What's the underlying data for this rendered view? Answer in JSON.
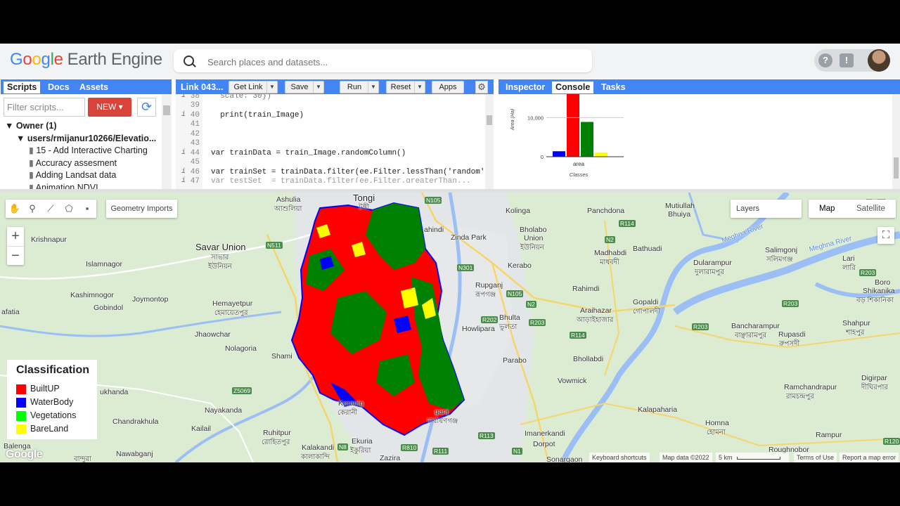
{
  "header": {
    "logo_google": [
      "G",
      "o",
      "o",
      "g",
      "l",
      "e"
    ],
    "logo_product": "Earth Engine",
    "search_placeholder": "Search places and datasets..."
  },
  "left_panel": {
    "tabs": [
      "Scripts",
      "Docs",
      "Assets"
    ],
    "filter_placeholder": "Filter scripts...",
    "new_label": "NEW",
    "tree": [
      {
        "label": "▼ Owner (1)",
        "bold": true
      },
      {
        "label": "▼ users/rmijanur10266/Elevatio...",
        "bold": true
      },
      {
        "label": "15 - Add Interactive Charting"
      },
      {
        "label": "Accuracy assesment"
      },
      {
        "label": "Adding Landsat data"
      },
      {
        "label": "Animation NDVI"
      }
    ]
  },
  "code_panel": {
    "title": "Link 043...",
    "buttons": {
      "get_link": "Get Link",
      "save": "Save",
      "run": "Run",
      "reset": "Reset",
      "apps": "Apps"
    },
    "lines": [
      {
        "n": "38",
        "info": true,
        "text": "  scale: 30})"
      },
      {
        "n": "39",
        "info": false,
        "text": ""
      },
      {
        "n": "40",
        "info": true,
        "text": "  print(train_Image)"
      },
      {
        "n": "41",
        "info": false,
        "text": ""
      },
      {
        "n": "42",
        "info": false,
        "text": ""
      },
      {
        "n": "43",
        "info": false,
        "text": ""
      },
      {
        "n": "44",
        "info": true,
        "text": "var trainData = train_Image.randomColumn()"
      },
      {
        "n": "45",
        "info": false,
        "text": ""
      },
      {
        "n": "46",
        "info": true,
        "text": "var trainSet = trainData.filter(ee.Filter.lessThan('random'"
      },
      {
        "n": "47",
        "info": true,
        "text": "var testSet  = trainData.filter(ee.Filter.greaterThan..."
      }
    ]
  },
  "right_panel": {
    "tabs": [
      "Inspector",
      "Console",
      "Tasks"
    ],
    "active_tab": "Console"
  },
  "chart_data": {
    "type": "bar",
    "categories": [
      "area"
    ],
    "series": [
      {
        "color": "#0000ff",
        "values": [
          1400
        ]
      },
      {
        "color": "#ff0000",
        "values": [
          16000
        ]
      },
      {
        "color": "#008000",
        "values": [
          8900
        ]
      },
      {
        "color": "#ffff00",
        "values": [
          1100
        ]
      }
    ],
    "xlabel": "Classes",
    "ylabel": "Area (Ha)",
    "yticks": [
      "0",
      "10,000"
    ],
    "ylim": [
      0,
      16000
    ]
  },
  "map": {
    "geometry_imports": "Geometry Imports",
    "layers_label": "Layers",
    "map_type": [
      "Map",
      "Satellite"
    ],
    "zoom_in": "+",
    "zoom_out": "−",
    "legend": {
      "title": "Classification",
      "items": [
        {
          "label": "BuiltUP",
          "color": "#ff0000"
        },
        {
          "label": "WaterBody",
          "color": "#0000ff"
        },
        {
          "label": "Vegetations",
          "color": "#00ff00"
        },
        {
          "label": "BareLand",
          "color": "#ffff00"
        }
      ]
    },
    "labels": [
      {
        "t": "Tongi",
        "cls": "big"
      },
      {
        "t": "টঙ্গী",
        "cls": "bn"
      },
      {
        "t": "Savar Union",
        "cls": "big"
      },
      {
        "t": "সাভার",
        "cls": "bn"
      },
      {
        "t": "ইউনিয়ন",
        "cls": "bn"
      },
      {
        "t": "Ashulia",
        "cls": ""
      },
      {
        "t": "আশুলিয়া",
        "cls": "bn"
      },
      {
        "t": "Krishnapur",
        "cls": ""
      },
      {
        "t": "Islamnagor",
        "cls": ""
      },
      {
        "t": "Kashimnogor",
        "cls": ""
      },
      {
        "t": "Gobindol",
        "cls": ""
      },
      {
        "t": "Joymontop",
        "cls": ""
      },
      {
        "t": "Hemayetpur",
        "cls": ""
      },
      {
        "t": "হেমায়েতপুর",
        "cls": "bn"
      },
      {
        "t": "Jhaowchar",
        "cls": ""
      },
      {
        "t": "Nolagoria",
        "cls": ""
      },
      {
        "t": "Shami",
        "cls": ""
      },
      {
        "t": "afatia",
        "cls": ""
      },
      {
        "t": "ukhanda",
        "cls": ""
      },
      {
        "t": "Nayakanda",
        "cls": ""
      },
      {
        "t": "Chandrakhula",
        "cls": ""
      },
      {
        "t": "Kailail",
        "cls": ""
      },
      {
        "t": "Ruhitpur",
        "cls": ""
      },
      {
        "t": "রোহিতপুর",
        "cls": "bn"
      },
      {
        "t": "Kalakandi",
        "cls": ""
      },
      {
        "t": "কালাকান্দি",
        "cls": "bn"
      },
      {
        "t": "Balenga",
        "cls": ""
      },
      {
        "t": "Nawabganj",
        "cls": ""
      },
      {
        "t": "বান্দুরা",
        "cls": "bn"
      },
      {
        "t": "Keranig",
        "cls": ""
      },
      {
        "t": "কেরানী",
        "cls": "bn"
      },
      {
        "t": "Ekuria",
        "cls": ""
      },
      {
        "t": "ইকুরিয়া",
        "cls": "bn"
      },
      {
        "t": "Zazira",
        "cls": ""
      },
      {
        "t": "ganj",
        "cls": ""
      },
      {
        "t": "নারায়ণগঞ্জ",
        "cls": "bn"
      },
      {
        "t": "Kolinga",
        "cls": ""
      },
      {
        "t": "Bholabo",
        "cls": ""
      },
      {
        "t": "Union",
        "cls": ""
      },
      {
        "t": "ইউনিয়ন",
        "cls": "bn"
      },
      {
        "t": "Zinda Park",
        "cls": ""
      },
      {
        "t": "ahindi",
        "cls": ""
      },
      {
        "t": "Kerabo",
        "cls": ""
      },
      {
        "t": "Rupganj",
        "cls": ""
      },
      {
        "t": "রূপগঞ্জ",
        "cls": "bn"
      },
      {
        "t": "Bhulta",
        "cls": ""
      },
      {
        "t": "ভুলতা",
        "cls": "bn"
      },
      {
        "t": "Howlipara",
        "cls": ""
      },
      {
        "t": "Parabo",
        "cls": ""
      },
      {
        "t": "Panchdona",
        "cls": ""
      },
      {
        "t": "Madhabdi",
        "cls": ""
      },
      {
        "t": "মাধবদী",
        "cls": "bn"
      },
      {
        "t": "Bathuadi",
        "cls": ""
      },
      {
        "t": "Rahimdi",
        "cls": ""
      },
      {
        "t": "Araihazar",
        "cls": ""
      },
      {
        "t": "আড়াইহাজার",
        "cls": "bn"
      },
      {
        "t": "Gopaldi",
        "cls": ""
      },
      {
        "t": "গোপালদী",
        "cls": "bn"
      },
      {
        "t": "Bhollabdi",
        "cls": ""
      },
      {
        "t": "Vowmick",
        "cls": ""
      },
      {
        "t": "Mutiullah",
        "cls": ""
      },
      {
        "t": "Bhuiya",
        "cls": ""
      },
      {
        "t": "Dularampur",
        "cls": ""
      },
      {
        "t": "দুলারামপুর",
        "cls": "bn"
      },
      {
        "t": "Salimgonj",
        "cls": ""
      },
      {
        "t": "সলিমগঞ্জ",
        "cls": "bn"
      },
      {
        "t": "Lari",
        "cls": ""
      },
      {
        "t": "লারি",
        "cls": "bn"
      },
      {
        "t": "Boro",
        "cls": ""
      },
      {
        "t": "Shikanika",
        "cls": ""
      },
      {
        "t": "বড় শিকানিকা",
        "cls": "bn"
      },
      {
        "t": "Bancharampur",
        "cls": ""
      },
      {
        "t": "বাঞ্ছারামপুর",
        "cls": "bn"
      },
      {
        "t": "Rupasdi",
        "cls": ""
      },
      {
        "t": "রুপসদী",
        "cls": "bn"
      },
      {
        "t": "Shahpur",
        "cls": ""
      },
      {
        "t": "শাহপুর",
        "cls": "bn"
      },
      {
        "t": "Digirpar",
        "cls": ""
      },
      {
        "t": "দীঘিরপার",
        "cls": "bn"
      },
      {
        "t": "Ramchandrapur",
        "cls": ""
      },
      {
        "t": "রামচন্দ্রপুর",
        "cls": "bn"
      },
      {
        "t": "Kalapaharia",
        "cls": ""
      },
      {
        "t": "Imanerkandi",
        "cls": ""
      },
      {
        "t": "Dorpot",
        "cls": ""
      },
      {
        "t": "Homna",
        "cls": ""
      },
      {
        "t": "হোমনা",
        "cls": "bn"
      },
      {
        "t": "Rampur",
        "cls": ""
      },
      {
        "t": "Roughnobor",
        "cls": ""
      },
      {
        "t": "Sonargaon",
        "cls": ""
      },
      {
        "t": "বাঞ্ছারা",
        "cls": "bn"
      },
      {
        "t": "Meghna River",
        "cls": "bn"
      },
      {
        "t": "Meghna River",
        "cls": "bn"
      }
    ],
    "shields": [
      "N105",
      "N511",
      "N301",
      "N105",
      "N2",
      "N2",
      "R202",
      "R203",
      "R114",
      "R114",
      "R203",
      "R203",
      "R203",
      "N105",
      "Z5069",
      "N8",
      "R810",
      "R111",
      "R113",
      "N1",
      "R120"
    ],
    "attribution": {
      "shortcuts": "Keyboard shortcuts",
      "data": "Map data ©2022",
      "scale": "5 km",
      "terms": "Terms of Use",
      "report": "Report a map error"
    },
    "google_logo": "Google"
  }
}
